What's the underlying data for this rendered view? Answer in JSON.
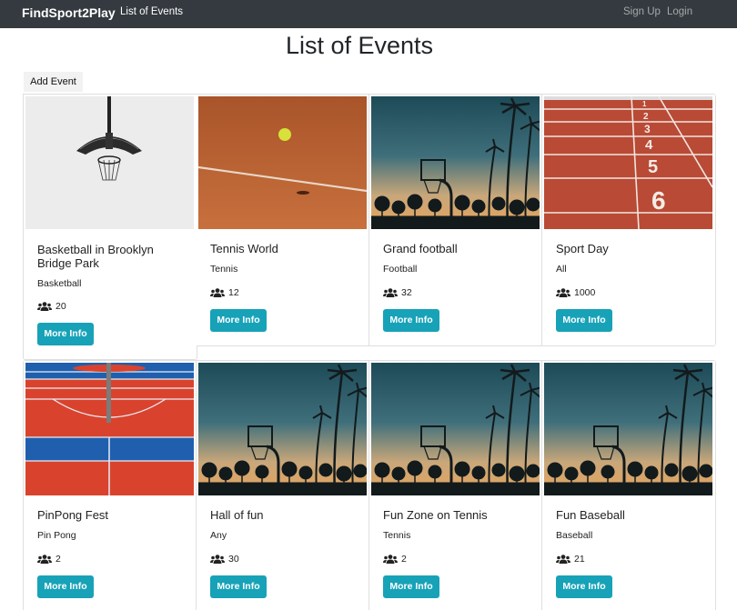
{
  "navbar": {
    "brand": "FindSport2Play",
    "links": [
      {
        "label": "List of Events"
      }
    ],
    "right_links": [
      {
        "label": "Sign Up"
      },
      {
        "label": "Login"
      }
    ]
  },
  "page": {
    "title": "List of Events",
    "add_button": "Add Event"
  },
  "events": [
    {
      "title": "Basketball in Brooklyn Bridge Park",
      "sport": "Basketball",
      "participants": "20",
      "button": "More Info",
      "image": "basketball-hoop-photo"
    },
    {
      "title": "Tennis World",
      "sport": "Tennis",
      "participants": "12",
      "button": "More Info",
      "image": "tennis-court-photo"
    },
    {
      "title": "Grand football",
      "sport": "Football",
      "participants": "32",
      "button": "More Info",
      "image": "palm-trees-hoop-photo"
    },
    {
      "title": "Sport Day",
      "sport": "All",
      "participants": "1000",
      "button": "More Info",
      "image": "running-track-photo"
    },
    {
      "title": "PinPong Fest",
      "sport": "Pin Pong",
      "participants": "2",
      "button": "More Info",
      "image": "sports-court-photo"
    },
    {
      "title": "Hall of fun",
      "sport": "Any",
      "participants": "30",
      "button": "More Info",
      "image": "palm-trees-hoop-photo"
    },
    {
      "title": "Fun Zone on Tennis",
      "sport": "Tennis",
      "participants": "2",
      "button": "More Info",
      "image": "palm-trees-hoop-photo"
    },
    {
      "title": "Fun Baseball",
      "sport": "Baseball",
      "participants": "21",
      "button": "More Info",
      "image": "palm-trees-hoop-photo"
    }
  ],
  "colors": {
    "navbar_bg": "#343a40",
    "info_button": "#17a2b8",
    "card_border": "#dfdfdf"
  },
  "icons": {
    "participants": "users-icon"
  }
}
